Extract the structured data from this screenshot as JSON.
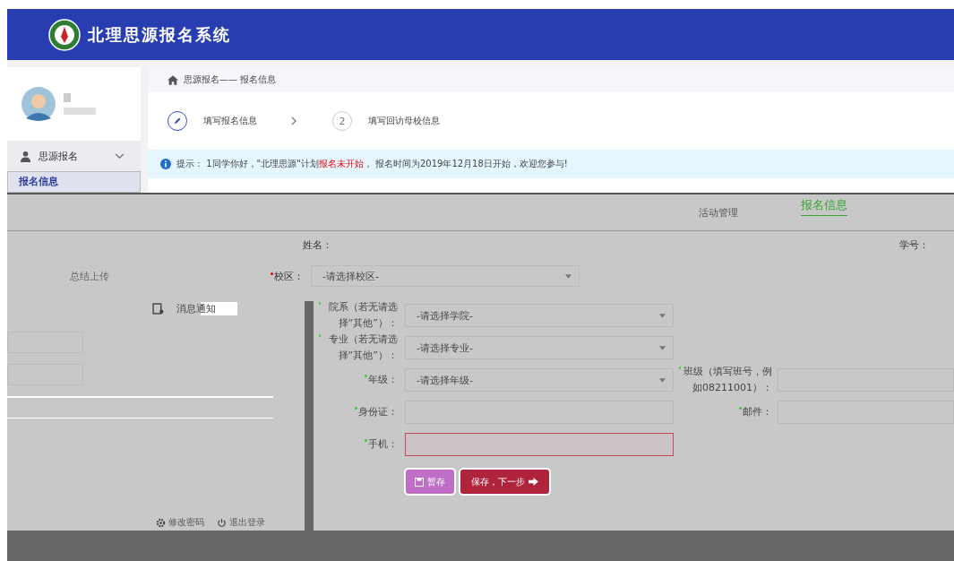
{
  "header": {
    "title": "北理思源报名系统"
  },
  "sidebar": {
    "menu": [
      {
        "label": "思源报名",
        "expanded": true,
        "children": [
          {
            "label": "报名信息",
            "selected": true
          }
        ]
      }
    ]
  },
  "breadcrumb": "思源报名—— 报名信息",
  "steps": [
    {
      "kind": "icon",
      "label": "填写报名信息",
      "active": true
    },
    {
      "kind": "number",
      "number": "2",
      "label": "填写回访母校信息",
      "active": false
    }
  ],
  "notice": {
    "label": "提示：",
    "parts": [
      {
        "text": "1同学你好，\"北理思源\"计划",
        "highlight": false
      },
      {
        "text": "报名未开始",
        "highlight": true
      },
      {
        "text": "， 报名时间为2019年12月18日开始，欢迎您参与!",
        "highlight": false
      }
    ]
  },
  "panel_tabs": [
    {
      "label": "活动管理",
      "selected": false
    },
    {
      "label": "报名信息",
      "selected": true
    }
  ],
  "top_fields": {
    "name_label": "姓名：",
    "student_id_label": "学号：",
    "summary_upload": "总结上传",
    "campus": {
      "label": "校区：",
      "value": "-请选择校区-",
      "required": true
    }
  },
  "left_menu": {
    "message": "消息通知",
    "footer": [
      {
        "kind": "settings",
        "label": "修改密码"
      },
      {
        "kind": "power",
        "label": "退出登录"
      }
    ]
  },
  "form": {
    "rows": [
      [
        {
          "kind": "select",
          "label": "院系（若无请选择“其他”）：",
          "value": "-请选择学院-",
          "required": true,
          "invalid": false
        }
      ],
      [
        {
          "kind": "select",
          "label": "专业（若无请选择“其他”）：",
          "value": "-请选择专业-",
          "required": true,
          "invalid": false
        }
      ],
      [
        {
          "kind": "select",
          "label": "年级：",
          "value": "-请选择年级-",
          "required": true,
          "invalid": false
        },
        {
          "kind": "input",
          "label": "班级（填写班号，例如08211001）：",
          "required": true,
          "invalid": false
        }
      ],
      [
        {
          "kind": "input",
          "label": "身份证：",
          "required": true,
          "invalid": false
        },
        {
          "kind": "input",
          "label": "邮件：",
          "required": true,
          "invalid": false
        }
      ],
      [
        {
          "kind": "input",
          "label": "手机：",
          "required": true,
          "invalid": true
        }
      ]
    ]
  },
  "buttons": [
    {
      "kind": "draft",
      "label": "暂存"
    },
    {
      "kind": "next",
      "label": "保存，下一步"
    }
  ]
}
